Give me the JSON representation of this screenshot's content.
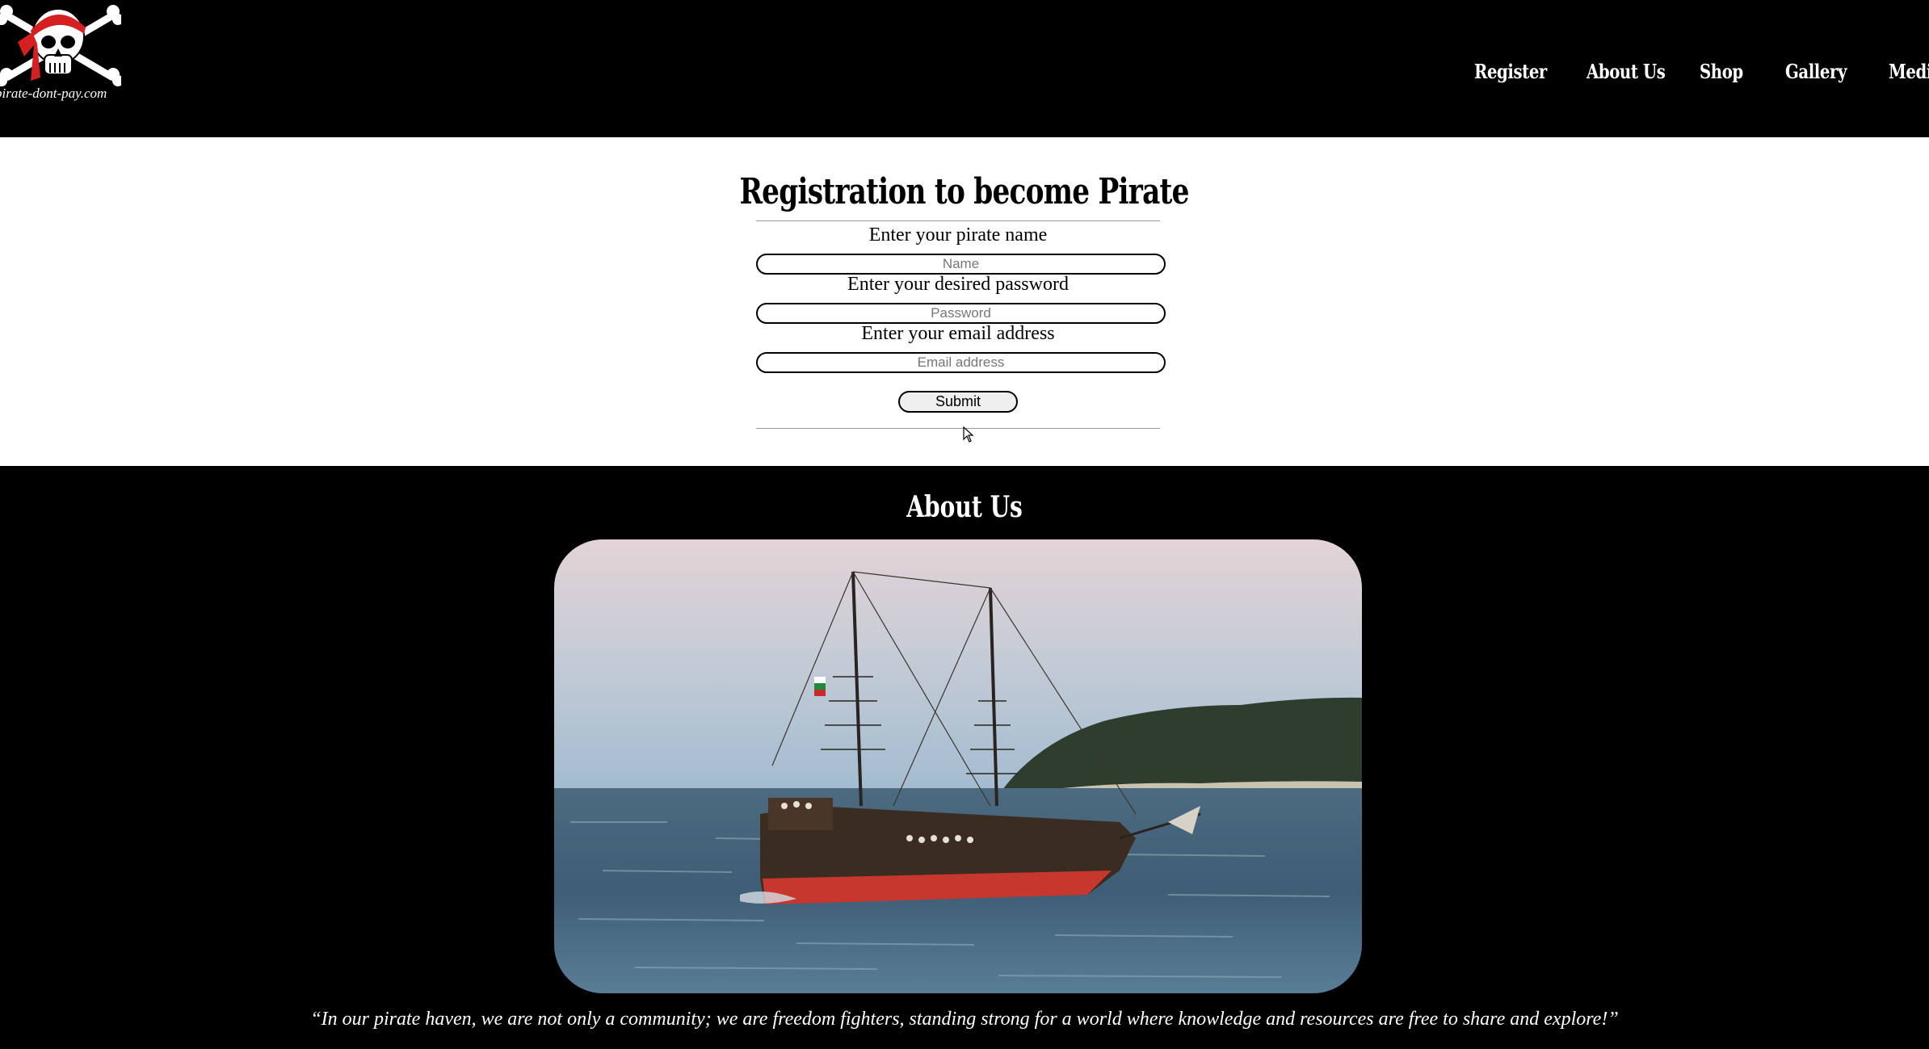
{
  "header": {
    "logo_text": "pirate-dont-pay.com",
    "nav": [
      {
        "label": "Register"
      },
      {
        "label": "About Us"
      },
      {
        "label": "Shop"
      },
      {
        "label": "Gallery"
      },
      {
        "label": "Media"
      }
    ]
  },
  "registration": {
    "title": "Registration to become Pirate",
    "name_label": "Enter your pirate name",
    "name_placeholder": "Name",
    "password_label": "Enter your desired password",
    "password_placeholder": "Password",
    "email_label": "Enter your email address",
    "email_placeholder": "Email address",
    "submit_label": "Submit"
  },
  "about": {
    "title": "About Us",
    "image_icon": "pirate-ship-photo",
    "quote": "“In our pirate haven, we are not only a community; we are freedom fighters, standing strong for a world where knowledge and resources are free to share and explore!”"
  },
  "colors": {
    "background_dark": "#000000",
    "background_light": "#ffffff",
    "bandana_red": "#d42020",
    "hull_red": "#c8372d"
  }
}
